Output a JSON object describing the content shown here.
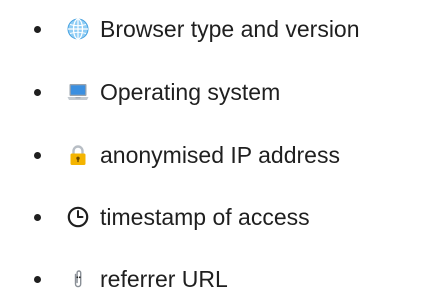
{
  "items": [
    {
      "icon": "globe-icon",
      "label": "Browser type and version"
    },
    {
      "icon": "laptop-icon",
      "label": "Operating system"
    },
    {
      "icon": "lock-icon",
      "label": "anonymised IP address"
    },
    {
      "icon": "clock-icon",
      "label": "timestamp of access"
    },
    {
      "icon": "paperclip-icon",
      "label": "referrer URL"
    }
  ],
  "colors": {
    "text": "#1f1f1f",
    "globe": "#7ec3f2",
    "laptop_screen": "#3b8fe0",
    "lock_body": "#f4b400"
  }
}
